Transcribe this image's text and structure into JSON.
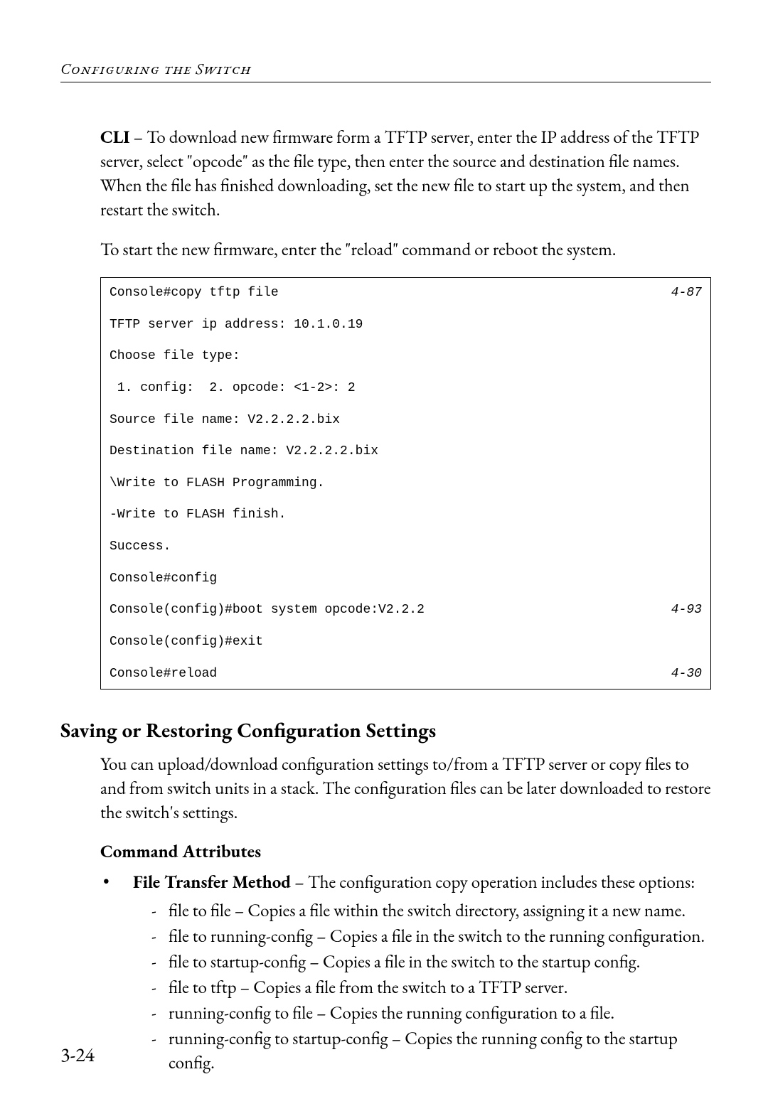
{
  "header": {
    "running_head": "Configuring the Switch"
  },
  "para1": {
    "lead": "CLI",
    "sep": " – ",
    "rest": "To download new firmware form a TFTP server, enter the IP address of the TFTP server, select \"opcode\" as the file type, then enter the source and destination file names. When the file has finished downloading, set the new file to start up the system, and then restart the switch."
  },
  "para2": "To start the new firmware, enter the \"reload\" command or reboot the system.",
  "console": {
    "lines": [
      {
        "text": "Console#copy tftp file",
        "ref": "4-87"
      },
      {
        "text": "TFTP server ip address: 10.1.0.19"
      },
      {
        "text": "Choose file type:"
      },
      {
        "text": " 1. config:  2. opcode: <1-2>: 2"
      },
      {
        "text": "Source file name: V2.2.2.2.bix"
      },
      {
        "text": "Destination file name: V2.2.2.2.bix"
      },
      {
        "text": "\\Write to FLASH Programming."
      },
      {
        "text": "-Write to FLASH finish."
      },
      {
        "text": "Success."
      },
      {
        "text": "Console#config"
      },
      {
        "text": "Console(config)#boot system opcode:V2.2.2",
        "ref": "4-93"
      },
      {
        "text": "Console(config)#exit"
      },
      {
        "text": "Console#reload",
        "ref": "4-30"
      }
    ]
  },
  "section_heading": "Saving or Restoring Configuration Settings",
  "section_para": "You can upload/download configuration settings to/from a TFTP server or copy files to and from switch units in a stack. The configuration files can be later downloaded to restore the switch's settings.",
  "cmd_attr_heading": "Command Attributes",
  "bullet": {
    "lead": "File Transfer Method",
    "sep": " – ",
    "rest": "The configuration copy operation includes these options:"
  },
  "dashes": [
    "file to file – Copies a file within the switch directory, assigning it a new name.",
    "file to running-config – Copies a file in the switch to the running configuration.",
    "file to startup-config – Copies a file in the switch to the startup config.",
    "file to tftp – Copies a file from the switch to a TFTP server.",
    "running-config to file – Copies the running configuration to a file.",
    " running-config to startup-config – Copies the running config to the startup config."
  ],
  "page_number": "3-24"
}
